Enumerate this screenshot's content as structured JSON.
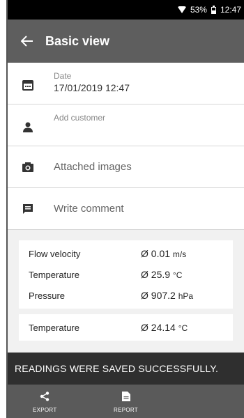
{
  "status_bar": {
    "battery": "53%",
    "time": "12:47"
  },
  "app_bar": {
    "title": "Basic view"
  },
  "details": {
    "date_label": "Date",
    "date_value": "17/01/2019 12:47",
    "add_customer": "Add customer",
    "attached_images": "Attached images",
    "write_comment": "Write comment"
  },
  "readings": {
    "group1": [
      {
        "name": "Flow velocity",
        "value": "Ø 0.01",
        "unit": "m/s"
      },
      {
        "name": "Temperature",
        "value": "Ø 25.9",
        "unit": "°C"
      },
      {
        "name": "Pressure",
        "value": "Ø 907.2",
        "unit": "hPa"
      }
    ],
    "group2": [
      {
        "name": "Temperature",
        "value": "Ø 24.14",
        "unit": "°C"
      }
    ]
  },
  "snackbar": {
    "message": "READINGS WERE SAVED SUCCESSFULLY."
  },
  "bottom_bar": {
    "export_label": "EXPORT",
    "report_label": "REPORT"
  },
  "icons": [
    "wifi-icon",
    "battery-icon",
    "back-arrow-icon",
    "calendar-icon",
    "person-icon",
    "camera-icon",
    "comment-icon",
    "share-icon",
    "document-icon"
  ]
}
